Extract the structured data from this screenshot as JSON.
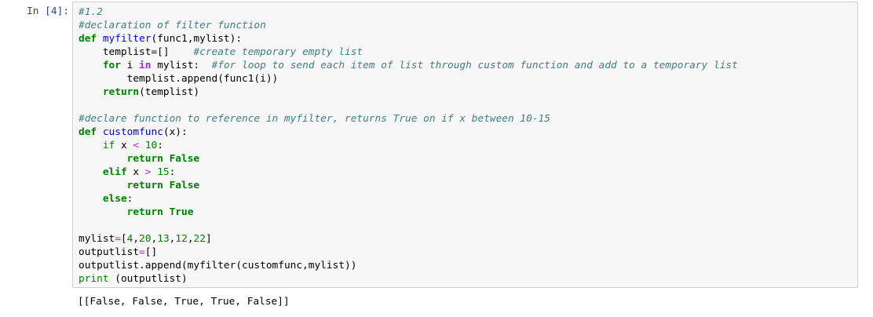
{
  "prompt": "In [4]:",
  "code": {
    "l01": {
      "comment": "#1.2"
    },
    "l02": {
      "comment": "#declaration of filter function"
    },
    "l03": {
      "kw": "def",
      "sp": " ",
      "fname": "myfilter",
      "rest": "(func1,mylist):"
    },
    "l04": {
      "indent": "    ",
      "text": "templist=[]",
      "gap": "    ",
      "comment": "#create temporary empty list"
    },
    "l05": {
      "indent": "    ",
      "kw": "for",
      "a": " i ",
      "kw2": "in",
      "b": " mylist:  ",
      "comment": "#for loop to send each item of list through custom function and add to a temporary list"
    },
    "l06": {
      "indent": "        ",
      "text": "templist.append(func1(i))"
    },
    "l07": {
      "indent": "    ",
      "kw": "return",
      "rest": "(templist)"
    },
    "l08": {
      "text": ""
    },
    "l09": {
      "comment": "#declare function to reference in myfilter, returns True on if x between 10-15"
    },
    "l10": {
      "kw": "def",
      "sp": " ",
      "fname": "customfunc",
      "rest": "(x):"
    },
    "l11": {
      "indent": "    ",
      "kw": "if",
      "a": " x ",
      "op": "<",
      "b": " ",
      "num": "10",
      "c": ":"
    },
    "l12": {
      "indent": "        ",
      "kw": "return",
      "sp": " ",
      "kw2": "False"
    },
    "l13": {
      "indent": "    ",
      "kw": "elif",
      "a": " x ",
      "op": ">",
      "b": " ",
      "num": "15",
      "c": ":"
    },
    "l14": {
      "indent": "        ",
      "kw": "return",
      "sp": " ",
      "kw2": "False"
    },
    "l15": {
      "indent": "    ",
      "kw": "else",
      "c": ":"
    },
    "l16": {
      "indent": "        ",
      "kw": "return",
      "sp": " ",
      "kw2": "True"
    },
    "l17": {
      "text": ""
    },
    "l18": {
      "a": "mylist",
      "op": "=",
      "b": "[",
      "n1": "4",
      "s1": ",",
      "n2": "20",
      "s2": ",",
      "n3": "13",
      "s3": ",",
      "n4": "12",
      "s4": ",",
      "n5": "22",
      "c": "]"
    },
    "l19": {
      "a": "outputlist",
      "op": "=",
      "b": "[]"
    },
    "l20": {
      "text": "outputlist.append(myfilter(customfunc,mylist))"
    },
    "l21": {
      "builtin": "print",
      "rest": " (outputlist)"
    }
  },
  "output": "[[False, False, True, True, False]]",
  "colors": {
    "prompt": "#303f9f",
    "comment": "#408080",
    "keyword": "#008000",
    "function_name": "#0000ff",
    "operator": "#aa22ff",
    "cell_background": "#f7f7f7",
    "cell_border": "#cfcfcf"
  }
}
